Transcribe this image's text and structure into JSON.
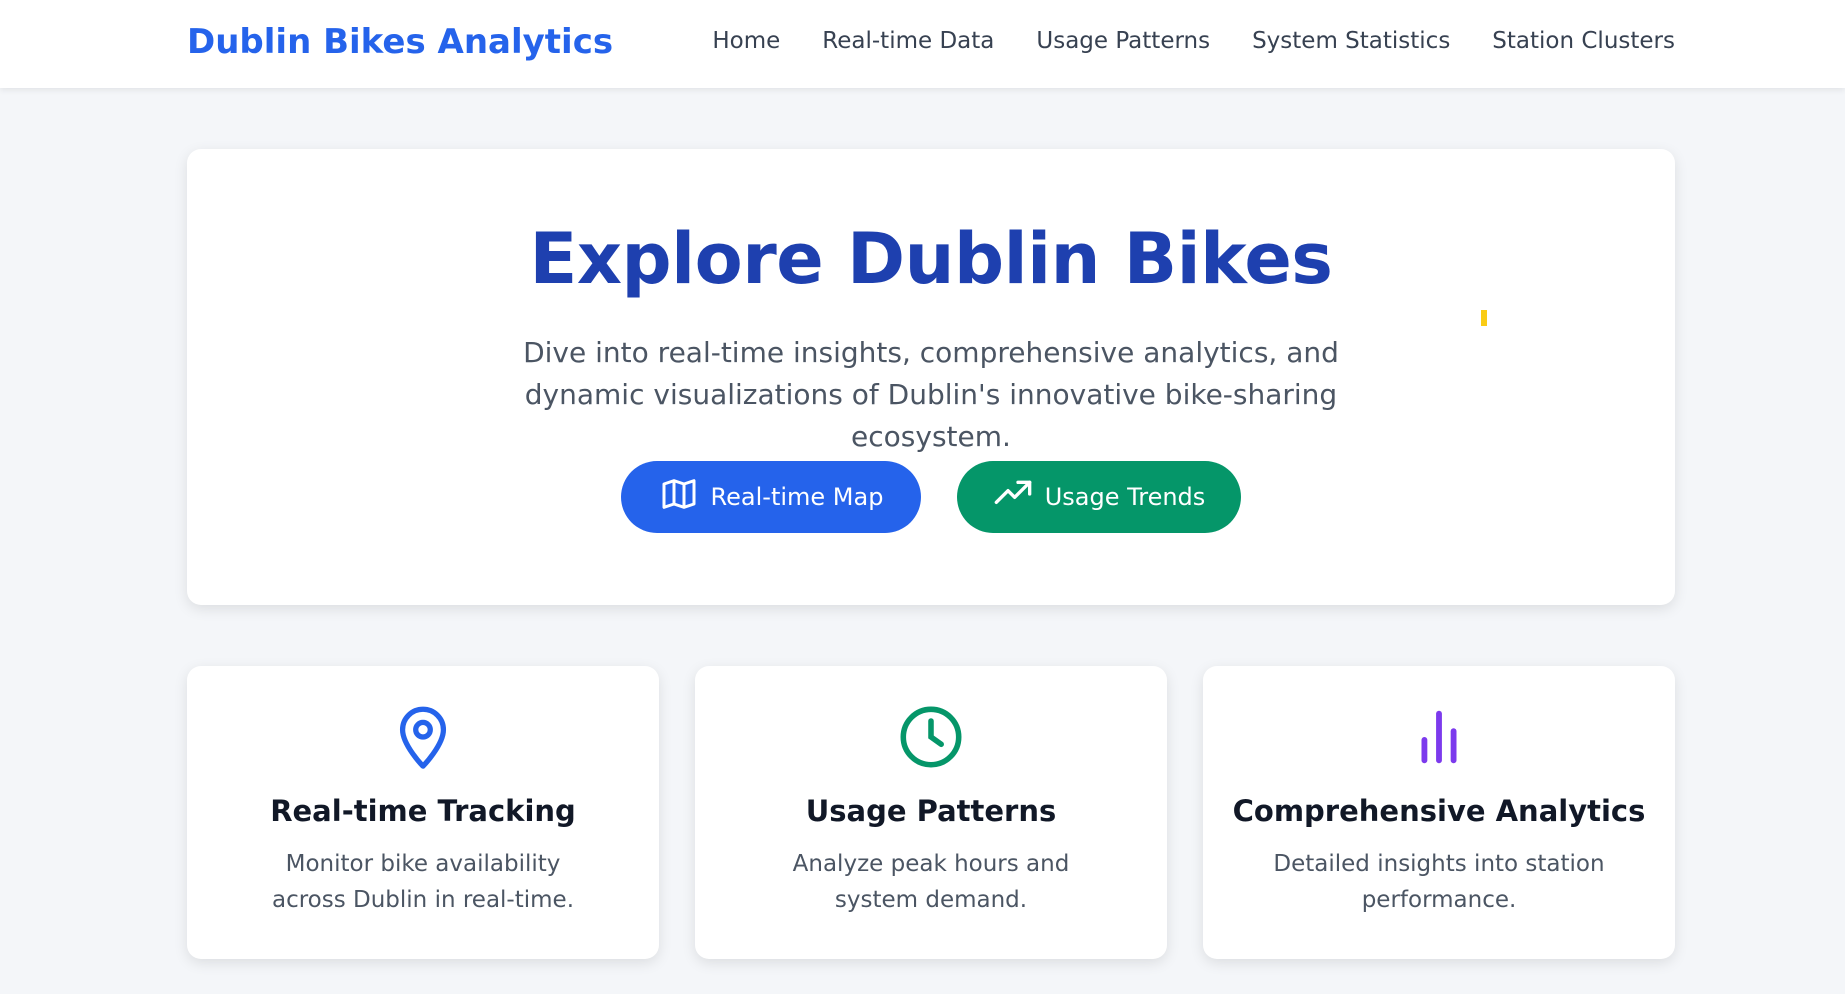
{
  "nav": {
    "brand": "Dublin Bikes Analytics",
    "links": [
      "Home",
      "Real-time Data",
      "Usage Patterns",
      "System Statistics",
      "Station Clusters"
    ]
  },
  "hero": {
    "title": "Explore Dublin Bikes",
    "subtitle": "Dive into real-time insights, comprehensive analytics, and dynamic visualizations of Dublin's innovative bike-sharing ecosystem.",
    "buttons": {
      "map": "Real-time Map",
      "trends": "Usage Trends"
    }
  },
  "features": [
    {
      "icon": "map-pin-icon",
      "title": "Real-time Tracking",
      "text": "Monitor bike availability across Dublin in real-time."
    },
    {
      "icon": "clock-icon",
      "title": "Usage Patterns",
      "text": "Analyze peak hours and system demand."
    },
    {
      "icon": "bar-chart-icon",
      "title": "Comprehensive Analytics",
      "text": "Detailed insights into station performance."
    }
  ],
  "colors": {
    "brand": "#2563eb",
    "hero_title": "#1e40af",
    "map_button": "#2563eb",
    "trends_button": "#059669",
    "pin_icon": "#2563eb",
    "clock_icon": "#059669",
    "chart_icon": "#7c3aed"
  }
}
